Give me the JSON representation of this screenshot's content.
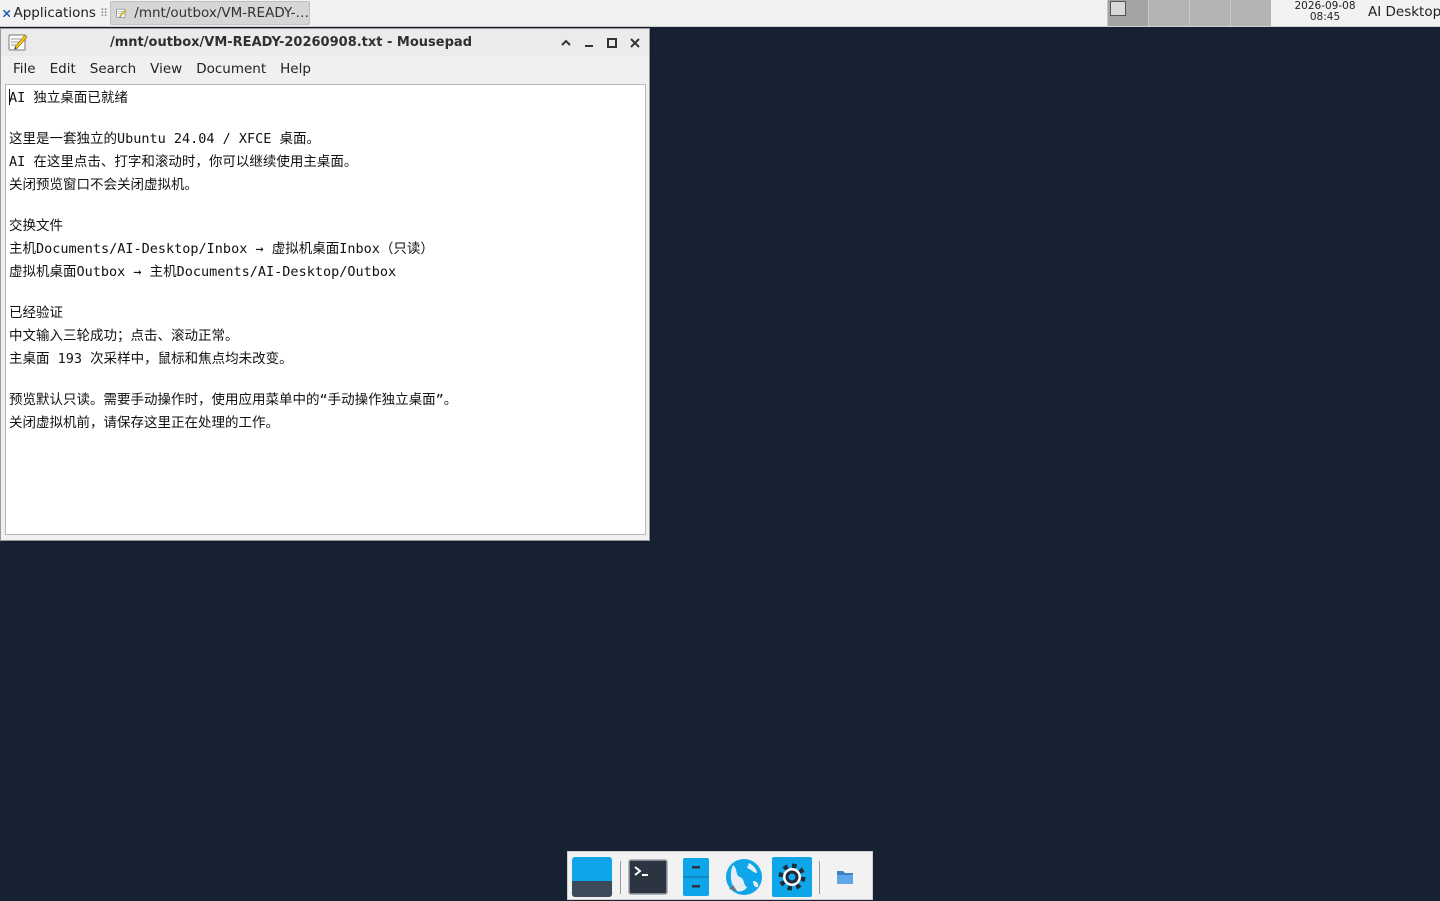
{
  "panel": {
    "applications_label": "Applications",
    "applications_separator": "⠿",
    "task_label": "/mnt/outbox/VM-READY-…",
    "clock_date": "2026-09-08",
    "clock_time": "08:45",
    "user_label": "AI Desktop"
  },
  "window": {
    "title": "/mnt/outbox/VM-READY-20260908.txt - Mousepad",
    "menu": [
      "File",
      "Edit",
      "Search",
      "View",
      "Document",
      "Help"
    ]
  },
  "document": {
    "first_line_rest": " 独立桌面已就绪",
    "first_line_start": "AI",
    "lines": [
      "",
      "这里是一套独立的Ubuntu 24.04 / XFCE 桌面。",
      "AI 在这里点击、打字和滚动时，你可以继续使用主桌面。",
      "关闭预览窗口不会关闭虚拟机。",
      "",
      "交换文件",
      "主机Documents/AI-Desktop/Inbox → 虚拟机桌面Inbox（只读）",
      "虚拟机桌面Outbox → 主机Documents/AI-Desktop/Outbox",
      "",
      "已经验证",
      "中文输入三轮成功；点击、滚动正常。",
      "主桌面 193 次采样中，鼠标和焦点均未改变。",
      "",
      "预览默认只读。需要手动操作时，使用应用菜单中的“手动操作独立桌面”。",
      "关闭虚拟机前，请保存这里正在处理的工作。"
    ]
  },
  "colors": {
    "desktop_bg": "#162132",
    "accent_blue": "#0ea5e9",
    "panel_bg": "#f2f2f2"
  },
  "icons": {
    "apps": "xfce-mouse-icon",
    "task": "text-editor-icon",
    "dock": [
      "show-desktop-icon",
      "terminal-icon",
      "file-manager-icon",
      "web-browser-icon",
      "settings-icon",
      "folder-icon"
    ]
  }
}
